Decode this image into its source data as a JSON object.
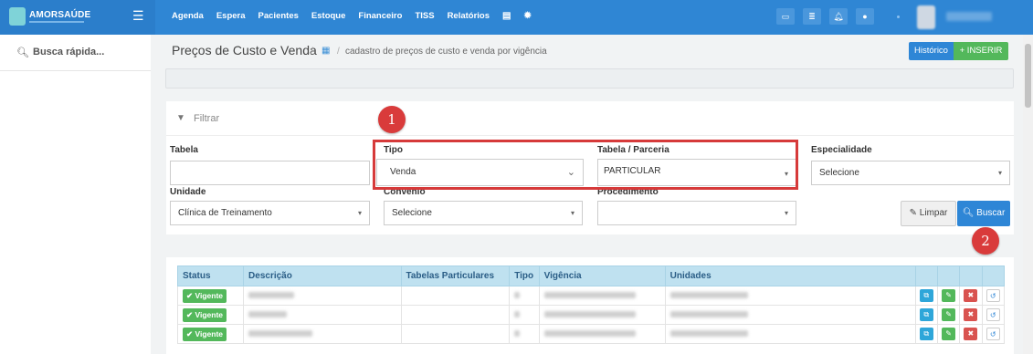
{
  "brand": {
    "name": "AMORSAÚDE"
  },
  "topnav": [
    "Agenda",
    "Espera",
    "Pacientes",
    "Estoque",
    "Financeiro",
    "TISS",
    "Relatórios"
  ],
  "icons": {
    "menu": "hamburger-icon",
    "db": "database-icon",
    "settings": "gear-icon"
  },
  "sidebar": {
    "quick_search": "Busca rápida..."
  },
  "header": {
    "title": "Preços de Custo e Venda",
    "sep": "/",
    "subtitle": "cadastro de preços de custo e venda por vigência",
    "historico": "Histórico",
    "inserir": "+ INSERIR"
  },
  "filter": {
    "title": "Filtrar",
    "tabela_label": "Tabela",
    "tabela_value": "",
    "tipo_label": "Tipo",
    "tipo_value": "Venda",
    "parceria_label": "Tabela / Parceria",
    "parceria_value": "PARTICULAR",
    "especialidade_label": "Especialidade",
    "especialidade_value": "Selecione",
    "unidade_label": "Unidade",
    "unidade_value": "Clínica de Treinamento",
    "convenio_label": "Convênio",
    "convenio_value": "Selecione",
    "procedimento_label": "Procedimento",
    "procedimento_value": "",
    "limpar": "Limpar",
    "buscar": "Buscar"
  },
  "markers": [
    "1",
    "2"
  ],
  "table": {
    "columns": [
      "Status",
      "Descrição",
      "Tabelas Particulares",
      "Tipo",
      "Vigência",
      "Unidades"
    ],
    "rows": [
      {
        "status": "Vigente"
      },
      {
        "status": "Vigente"
      },
      {
        "status": "Vigente"
      }
    ]
  },
  "colors": {
    "topbar": "#2f86d4",
    "highlight": "#d63a3a",
    "success": "#53b85b",
    "primary": "#2e86d6"
  }
}
